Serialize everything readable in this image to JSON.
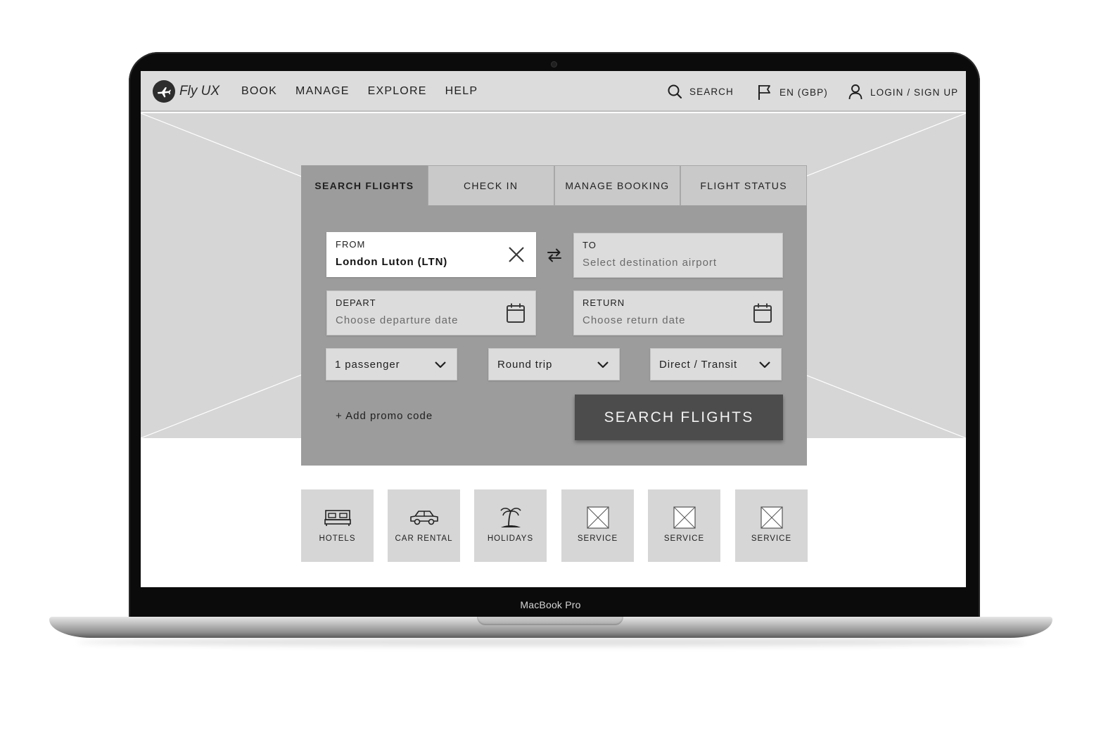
{
  "device": {
    "label": "MacBook Pro"
  },
  "header": {
    "logo_text": "Fly UX",
    "nav": [
      "BOOK",
      "MANAGE",
      "EXPLORE",
      "HELP"
    ],
    "search_label": "SEARCH",
    "language_label": "EN (GBP)",
    "login_label": "LOGIN / SIGN UP"
  },
  "widget": {
    "tabs": [
      "SEARCH FLIGHTS",
      "CHECK IN",
      "MANAGE BOOKING",
      "FLIGHT STATUS"
    ],
    "active_tab": "SEARCH FLIGHTS",
    "from": {
      "label": "FROM",
      "value": "London Luton (LTN)"
    },
    "to": {
      "label": "TO",
      "placeholder": "Select destination airport"
    },
    "depart": {
      "label": "DEPART",
      "placeholder": "Choose departure date"
    },
    "return": {
      "label": "RETURN",
      "placeholder": "Choose return date"
    },
    "passengers": "1 passenger",
    "trip_type": "Round trip",
    "connection": "Direct / Transit",
    "promo": "+ Add promo code",
    "search_button": "SEARCH FLIGHTS"
  },
  "services": [
    {
      "label": "HOTELS",
      "icon": "bed-icon"
    },
    {
      "label": "CAR RENTAL",
      "icon": "car-icon"
    },
    {
      "label": "HOLIDAYS",
      "icon": "palm-tree-icon"
    },
    {
      "label": "SERVICE",
      "icon": "image-placeholder-icon"
    },
    {
      "label": "SERVICE",
      "icon": "image-placeholder-icon"
    },
    {
      "label": "SERVICE",
      "icon": "image-placeholder-icon"
    }
  ]
}
